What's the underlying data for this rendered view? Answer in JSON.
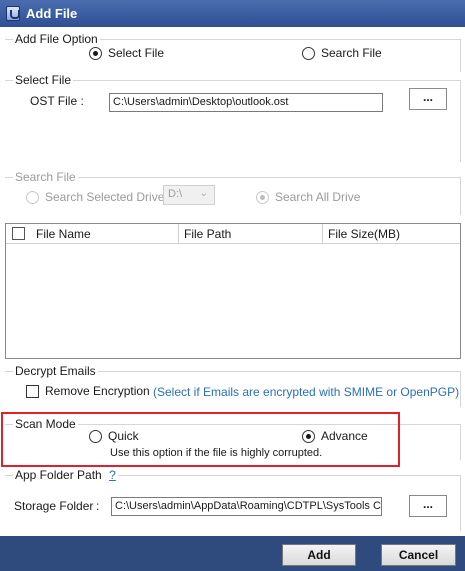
{
  "window": {
    "title": "Add File",
    "icon": "app-shield-icon"
  },
  "add_file_option": {
    "group_label": "Add File Option",
    "select_file_label": "Select File",
    "search_file_label": "Search File",
    "selected": "select_file"
  },
  "select_file": {
    "group_label": "Select File",
    "ost_label": "OST File :",
    "ost_value": "C:\\Users\\admin\\Desktop\\outlook.ost",
    "browse_label": "..."
  },
  "search_file": {
    "group_label": "Search File",
    "selected_drive_label": "Search Selected Drive",
    "drive_value": "D:\\",
    "all_drive_label": "Search All Drive"
  },
  "file_table": {
    "columns": [
      "File Name",
      "File Path",
      "File Size(MB)"
    ],
    "rows": []
  },
  "decrypt": {
    "group_label": "Decrypt Emails",
    "remove_label": "Remove Encryption",
    "hint": "(Select if Emails are encrypted with SMIME or OpenPGP)"
  },
  "scan_mode": {
    "group_label": "Scan Mode",
    "quick_label": "Quick",
    "advance_label": "Advance",
    "selected": "advance",
    "hint": "Use this option if the file is highly corrupted."
  },
  "app_folder": {
    "group_label": "App Folder Path",
    "help_label": "?",
    "storage_label": "Storage Folder",
    "storage_colon": ":",
    "storage_value": "C:\\Users\\admin\\AppData\\Roaming\\CDTPL\\SysTools C",
    "browse_label": "..."
  },
  "footer": {
    "add_label": "Add",
    "cancel_label": "Cancel"
  },
  "colors": {
    "title_bar": "#2f4f94",
    "footer": "#2f4a7d",
    "highlight": "#e0202a",
    "hint": "#2b6fb8"
  }
}
